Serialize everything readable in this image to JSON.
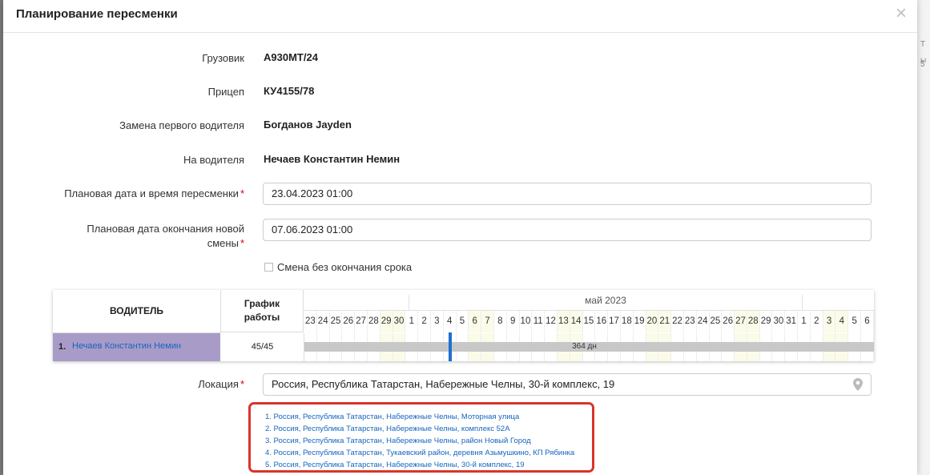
{
  "background_right": [
    "Т",
    "ы",
    "5"
  ],
  "modal": {
    "title": "Планирование пересменки",
    "close_icon": "close-icon"
  },
  "fields": {
    "truck_label": "Грузовик",
    "truck_value": "А930МТ/24",
    "trailer_label": "Прицеп",
    "trailer_value": "КУ4155/78",
    "replace_label": "Замена первого водителя",
    "replace_value": "Богданов Jayden",
    "to_driver_label": "На водителя",
    "to_driver_value": "Нечаев Константин Немин",
    "plan_date_label": "Плановая дата и время пересменки",
    "plan_date_value": "23.04.2023 01:00",
    "end_date_label_1": "Плановая дата окончания новой",
    "end_date_label_2": "смены",
    "end_date_value": "07.06.2023 01:00",
    "no_end_label": "Смена без окончания срока",
    "required_mark": "*"
  },
  "schedule": {
    "col_driver": "ВОДИТЕЛЬ",
    "col_work_1": "График",
    "col_work_2": "работы",
    "month": "май 2023",
    "days": [
      "23",
      "24",
      "25",
      "26",
      "27",
      "28",
      "29",
      "30",
      "1",
      "2",
      "3",
      "4",
      "5",
      "6",
      "7",
      "8",
      "9",
      "10",
      "11",
      "12",
      "13",
      "14",
      "15",
      "16",
      "17",
      "18",
      "19",
      "20",
      "21",
      "22",
      "23",
      "24",
      "25",
      "26",
      "27",
      "28",
      "29",
      "30",
      "31",
      "1",
      "2",
      "3",
      "4",
      "5",
      "6"
    ],
    "weekend_indices": [
      6,
      7,
      13,
      14,
      20,
      21,
      27,
      28,
      34,
      35,
      41,
      42
    ],
    "row": {
      "num": "1.",
      "name": "Нечаев Константин Немин",
      "work": "45/45",
      "bar_label": "364 дн"
    }
  },
  "location": {
    "label": "Локация",
    "value": "Россия, Республика Татарстан, Набережные Челны, 30-й комплекс, 19",
    "icon": "map-pin-icon",
    "suggestions": [
      "1. Россия, Республика Татарстан, Набережные Челны, Моторная улица",
      "2. Россия, Республика Татарстан, Набережные Челны, комплекс 52А",
      "3. Россия, Республика Татарстан, Набережные Челны, район Новый Город",
      "4. Россия, Республика Татарстан, Тукаевский район, деревня Азьмушкино, КП Рябинка",
      "5. Россия, Республика Татарстан, Набережные Челны, 30-й комплекс, 19"
    ]
  },
  "colors": {
    "accent": "#1565c0",
    "highlight_border": "#d9342b",
    "driver_row": "#a99bc7",
    "today_marker": "#1e6fd0"
  }
}
